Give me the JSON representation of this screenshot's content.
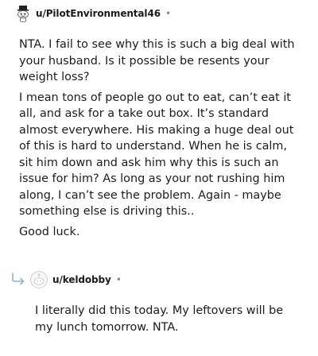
{
  "comment1": {
    "username": "u/PilotEnvironmental46",
    "separator": "•",
    "paragraphs": [
      "NTA. I fail to see why this is such a big deal with your husband. Is it possible be resents your weight loss?",
      "I mean tons of people go out to eat, can’t eat it all, and ask for a take out box. It’s standard almost everywhere. His making a huge deal out of this is hard to understand. When he is calm, sit him down and ask him why this is such an issue for him? As long as your not rushing him along, I can’t see the problem. Again - maybe something else is driving this..",
      "Good luck."
    ]
  },
  "comment2": {
    "username": "u/keldobby",
    "separator": "•",
    "paragraphs": [
      "I literally did this today. My leftovers will be my lunch tomorrow. NTA."
    ]
  },
  "icons": {
    "avatar1": "snoo-top-hat-avatar-icon",
    "avatar2": "snoo-default-avatar-icon",
    "reply": "reply-arrow-icon"
  },
  "colors": {
    "text": "#1c1c1c",
    "muted": "#878a8c",
    "reply_arrow": "#8fb0d8"
  }
}
